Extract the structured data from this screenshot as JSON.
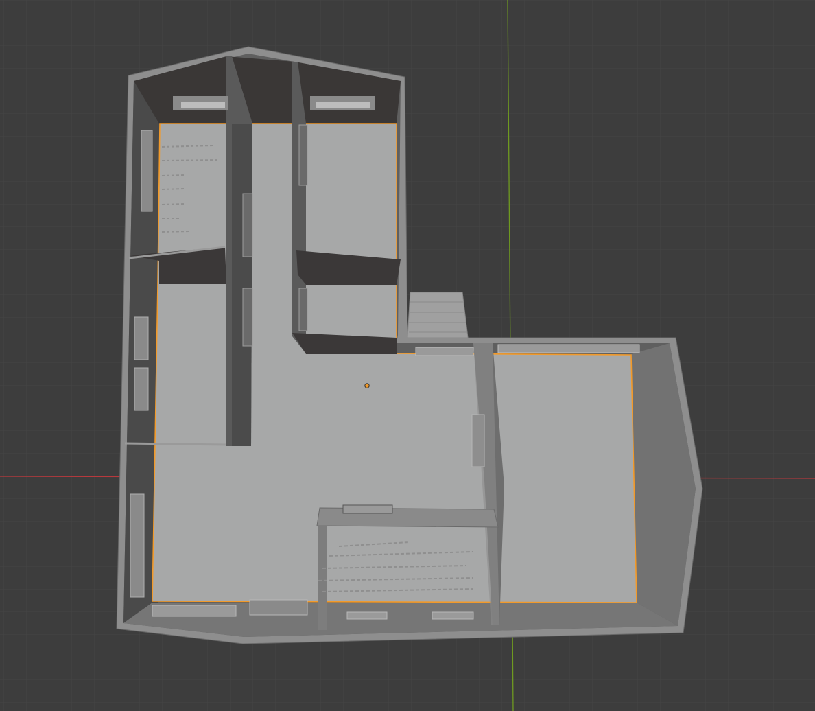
{
  "viewport": {
    "background": "#3d3d3d",
    "grid_minor_color": "#474747",
    "x_axis_color": "#c0393e",
    "y_axis_color": "#6f9a20",
    "selection_color": "#f29a2a"
  },
  "scene": {
    "object": "floor-plan-model",
    "selected": true,
    "origin_marker": "object-origin"
  }
}
